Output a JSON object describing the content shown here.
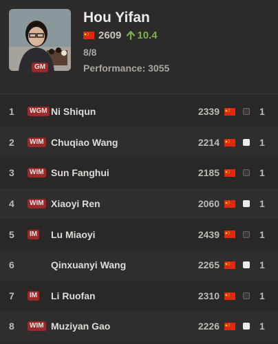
{
  "player": {
    "name": "Hou Yifan",
    "title": "GM",
    "flag_icon": "china-flag-icon",
    "rating": "2609",
    "gain": "10.4",
    "score": "8/8",
    "performance": "Performance: 3055"
  },
  "opponents": [
    {
      "num": "1",
      "title": "WGM",
      "name": "Ni Shiqun",
      "rating": "2339",
      "color": "black",
      "points": "1"
    },
    {
      "num": "2",
      "title": "WIM",
      "name": "Chuqiao Wang",
      "rating": "2214",
      "color": "white",
      "points": "1"
    },
    {
      "num": "3",
      "title": "WIM",
      "name": "Sun Fanghui",
      "rating": "2185",
      "color": "black",
      "points": "1"
    },
    {
      "num": "4",
      "title": "WIM",
      "name": "Xiaoyi Ren",
      "rating": "2060",
      "color": "white",
      "points": "1"
    },
    {
      "num": "5",
      "title": "IM",
      "name": "Lu Miaoyi",
      "rating": "2439",
      "color": "black",
      "points": "1"
    },
    {
      "num": "6",
      "title": "",
      "name": "Qinxuanyi Wang",
      "rating": "2265",
      "color": "white",
      "points": "1"
    },
    {
      "num": "7",
      "title": "IM",
      "name": "Li Ruofan",
      "rating": "2310",
      "color": "black",
      "points": "1"
    },
    {
      "num": "8",
      "title": "WIM",
      "name": "Muziyan Gao",
      "rating": "2226",
      "color": "white",
      "points": "1"
    }
  ],
  "colors": {
    "background": "#2a2826",
    "title_badge": "#9b2a2a",
    "gain_green": "#7fb14a"
  }
}
